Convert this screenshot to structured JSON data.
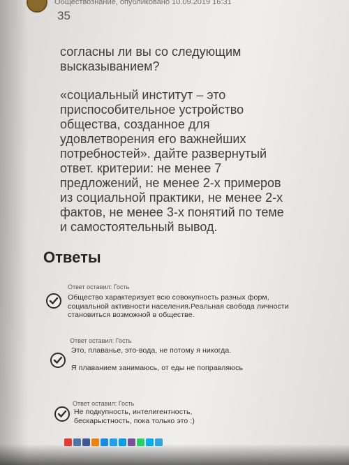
{
  "question": {
    "meta": "Обществознание, опубликовано 10.09.2019 16:31",
    "points": "35",
    "paragraphs": [
      "согласны ли вы со следующим высказыванием?",
      "«социальный институт – это приспособительное устройство общества, созданное для удовлетворения его важнейших потребностей». дайте развернутый ответ. критерии: не менее 7 предложений, не менее 2-х примеров из социальной практики, не менее 2-х фактов, не менее 3-х понятий по теме и самостоятельный вывод."
    ]
  },
  "answers_title": "Ответы",
  "answers": [
    {
      "author": "Ответ оставил: Гость",
      "paragraphs": [
        "Общество характеризует всю совокупность разных форм, социальной активности населения.Реальная свобода личности становиться возможной в обществе."
      ]
    },
    {
      "author": "Ответ оставил: Гость",
      "paragraphs": [
        "Это, плаванье, это-вода, не потому я никогда.",
        "Я плаванием занимаюсь, от еды не поправляюсь"
      ]
    },
    {
      "author": "Ответ оставил: Гость",
      "paragraphs": [
        "Не подкупность, интелигентность, бескарыстность, пока только это :)"
      ]
    }
  ],
  "share_icons": [
    {
      "name": "yandex-icon",
      "color": "#e53935"
    },
    {
      "name": "vk-icon",
      "color": "#4a76a8"
    },
    {
      "name": "facebook-icon",
      "color": "#3b5998"
    },
    {
      "name": "odnoklassniki-icon",
      "color": "#ee8208"
    },
    {
      "name": "mailru-icon",
      "color": "#168de2"
    },
    {
      "name": "twitter-icon",
      "color": "#1da1f2"
    },
    {
      "name": "livejournal-icon",
      "color": "#00a0e8"
    },
    {
      "name": "viber-icon",
      "color": "#7b519d"
    },
    {
      "name": "whatsapp-icon",
      "color": "#25d366"
    },
    {
      "name": "skype-icon",
      "color": "#00aff0"
    },
    {
      "name": "telegram-icon",
      "color": "#2ca5e0"
    }
  ]
}
